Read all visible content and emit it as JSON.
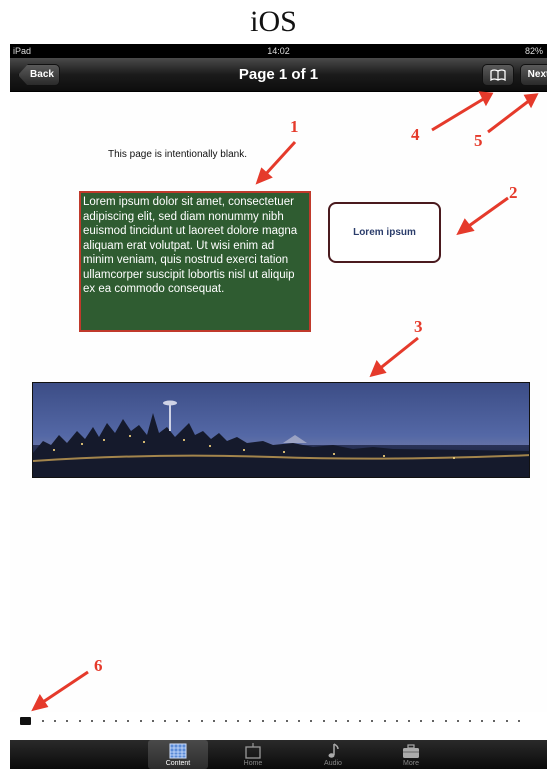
{
  "caption": "iOS",
  "status_bar": {
    "carrier": "iPad",
    "time": "14:02",
    "battery": "82%"
  },
  "nav": {
    "back_label": "Back",
    "title": "Page 1 of 1",
    "next_label": "Next",
    "bookmark_icon": "book-icon"
  },
  "page": {
    "blank_text": "This page is intentionally blank.",
    "text_box": "Lorem ipsum dolor sit amet, consectetuer adipiscing elit, sed diam nonummy nibh euismod tincidunt ut laoreet dolore magna aliquam erat volutpat. Ut wisi enim ad minim veniam, quis nostrud exerci tation ullamcorper suscipit lobortis nisl ut aliquip ex ea commodo consequat.",
    "button_label": "Lorem ipsum"
  },
  "annotations": [
    "1",
    "2",
    "3",
    "4",
    "5",
    "6"
  ],
  "annotation_color": "#e53a2b",
  "text_box_color": "#2f5c31",
  "tabs": [
    {
      "label": "Content",
      "icon": "grid-calendar-icon",
      "active": true
    },
    {
      "label": "Home",
      "icon": "tv-icon",
      "active": false
    },
    {
      "label": "Audio",
      "icon": "music-note-icon",
      "active": false
    },
    {
      "label": "More",
      "icon": "briefcase-icon",
      "active": false
    }
  ]
}
